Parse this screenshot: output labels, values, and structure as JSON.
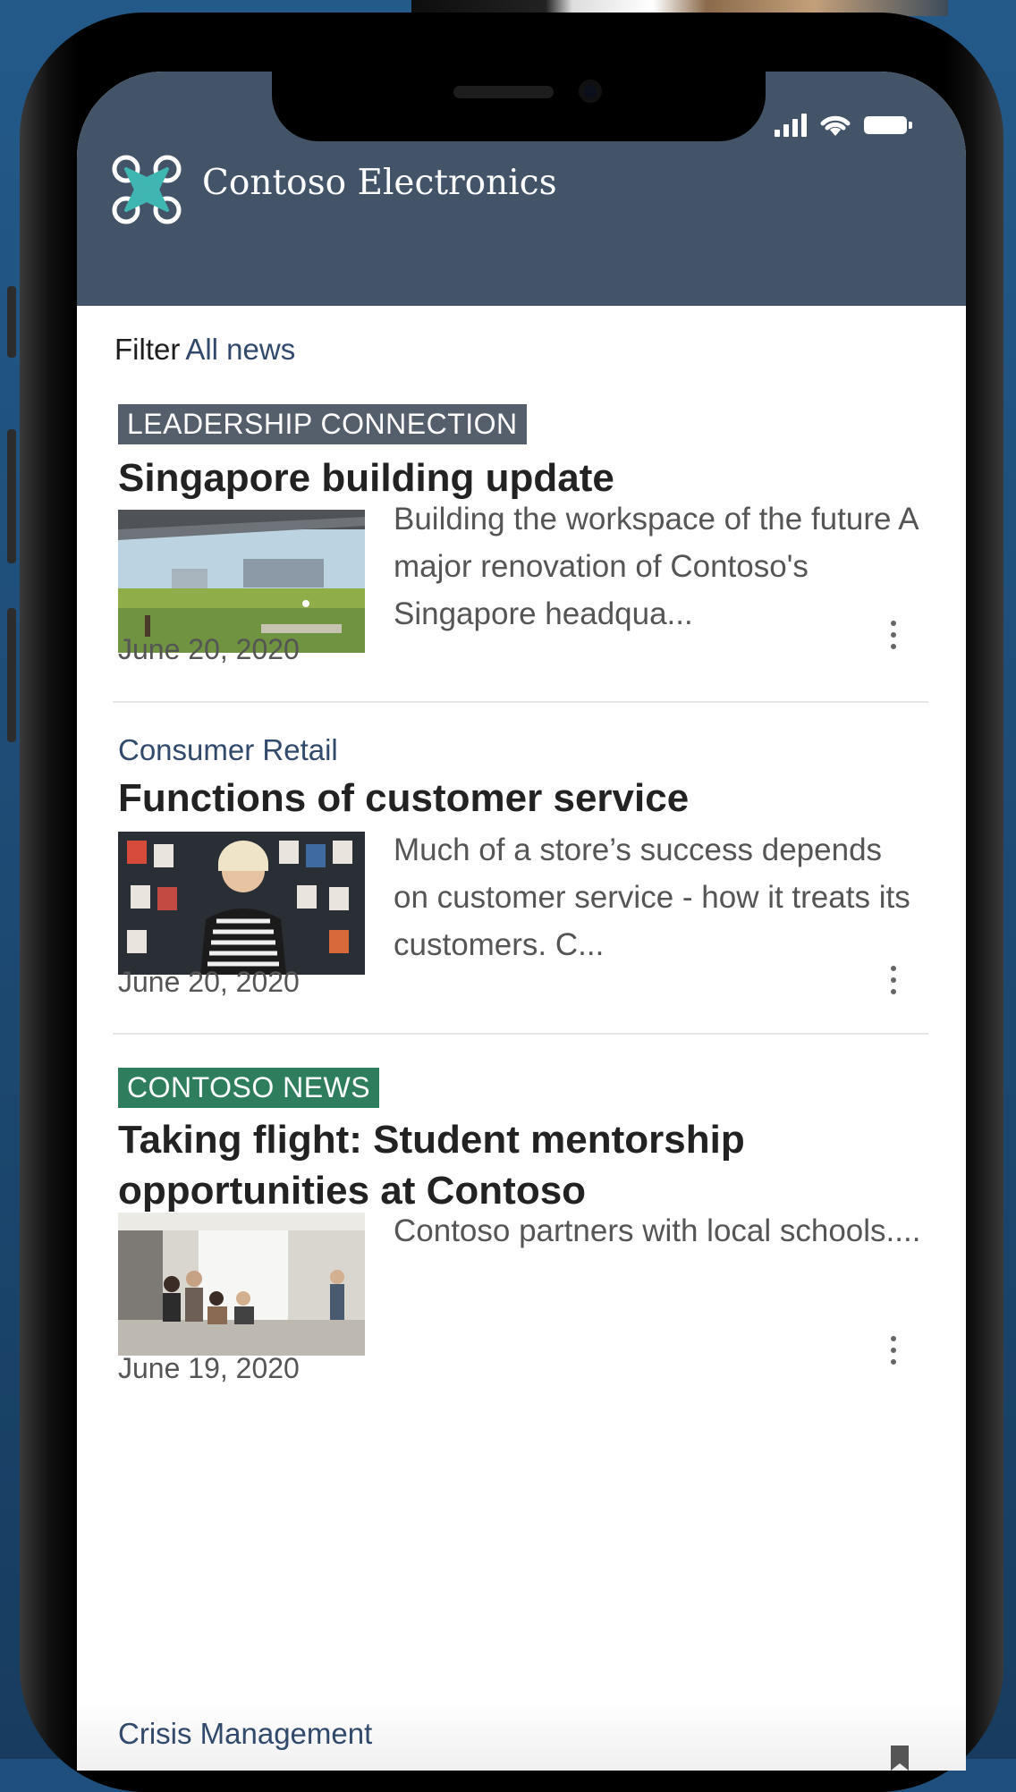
{
  "colors": {
    "header_bg": "#435368",
    "tag_leadership": "#555f6b",
    "tag_news": "#2e7e5e",
    "link_text": "#31496b",
    "logo_accent": "#3fb6b2"
  },
  "app": {
    "title": "Contoso Electronics",
    "logo_icon": "drone-icon"
  },
  "status_bar": {
    "icons": [
      "signal-icon",
      "wifi-icon",
      "battery-icon"
    ]
  },
  "filter": {
    "label": "Filter",
    "value": "All news"
  },
  "articles": [
    {
      "tag": "LEADERSHIP CONNECTION",
      "title": "Singapore building update",
      "excerpt": "Building the workspace of the future A major renovation of Contoso's Singapore headqua...",
      "date": "June 20, 2020"
    },
    {
      "category": "Consumer Retail",
      "title": "Functions of customer service",
      "excerpt": "Much of a store’s success depends on customer service - how it treats its customers. C...",
      "date": "June 20, 2020"
    },
    {
      "tag": "CONTOSO NEWS",
      "title": "Taking flight: Student mentorship opportunities at Contoso",
      "excerpt": "Contoso partners with local schools....",
      "date": "June 19, 2020"
    },
    {
      "category": "Crisis Management"
    }
  ]
}
